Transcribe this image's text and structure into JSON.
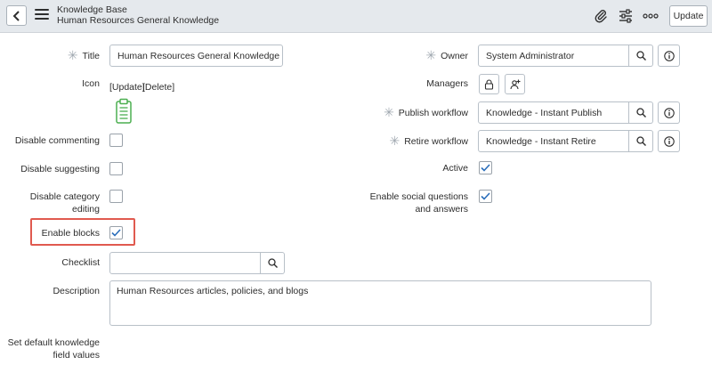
{
  "header": {
    "title": "Knowledge Base",
    "subtitle": "Human Resources General Knowledge",
    "update_label": "Update"
  },
  "form": {
    "title": {
      "label": "Title",
      "value": "Human Resources General Knowledge"
    },
    "icon": {
      "label": "Icon",
      "update_link": "[Update]",
      "delete_link": "[Delete]"
    },
    "disable_commenting": {
      "label": "Disable commenting",
      "checked": false
    },
    "disable_suggesting": {
      "label": "Disable suggesting",
      "checked": false
    },
    "disable_category_editing": {
      "label_line1": "Disable category",
      "label_line2": "editing",
      "checked": false
    },
    "enable_blocks": {
      "label": "Enable blocks",
      "checked": true
    },
    "checklist": {
      "label": "Checklist",
      "value": ""
    },
    "description": {
      "label": "Description",
      "value": "Human Resources articles, policies, and blogs"
    },
    "set_default": {
      "label_line1": "Set default knowledge",
      "label_line2": "field values"
    },
    "owner": {
      "label": "Owner",
      "value": "System Administrator"
    },
    "managers": {
      "label": "Managers"
    },
    "publish_workflow": {
      "label": "Publish workflow",
      "value": "Knowledge - Instant Publish"
    },
    "retire_workflow": {
      "label": "Retire workflow",
      "value": "Knowledge - Instant Retire"
    },
    "active": {
      "label": "Active",
      "checked": true
    },
    "enable_social": {
      "label_line1": "Enable social questions",
      "label_line2": "and answers",
      "checked": true
    }
  },
  "colors": {
    "header_bg": "#e5e9ed",
    "checkmark": "#2a6ebb",
    "highlight": "#e05a4f",
    "icon_green": "#4caf50"
  }
}
